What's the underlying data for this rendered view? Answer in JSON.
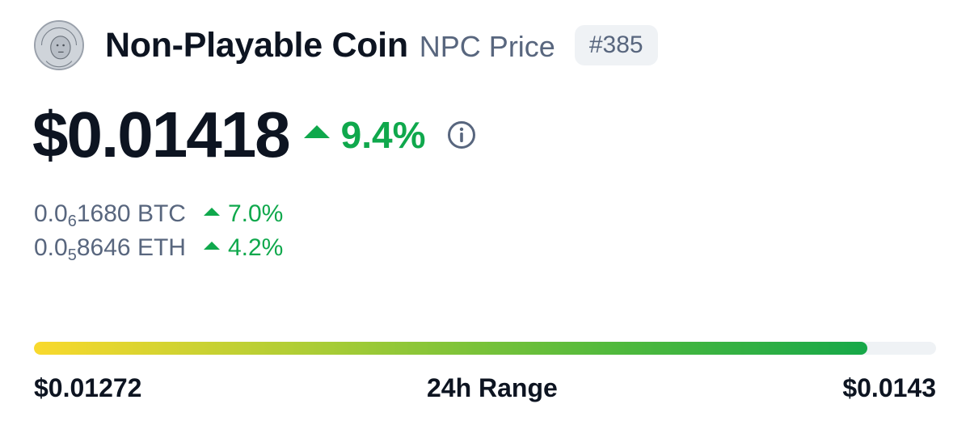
{
  "header": {
    "coin_name": "Non-Playable Coin",
    "symbol_price_label": "NPC Price",
    "rank": "#385",
    "logo_icon": "npc-wojak-logo-icon"
  },
  "price": {
    "value": "$0.01418",
    "change": "9.4%",
    "change_direction": "up",
    "info_icon": "info-icon"
  },
  "conversions": [
    {
      "prefix": "0.0",
      "subscript": "6",
      "digits": "1680",
      "unit": "BTC",
      "change": "7.0%",
      "direction": "up"
    },
    {
      "prefix": "0.0",
      "subscript": "5",
      "digits": "8646",
      "unit": "ETH",
      "change": "4.2%",
      "direction": "up"
    }
  ],
  "range_24h": {
    "low": "$0.01272",
    "label": "24h Range",
    "high": "$0.0143",
    "position_fraction": 0.924
  },
  "colors": {
    "positive": "#0fa84c",
    "primary_text": "#0d1421",
    "secondary_text": "#58667e",
    "badge_bg": "#eff2f5",
    "range_start": "#f9d92d",
    "range_end": "#16a849"
  }
}
